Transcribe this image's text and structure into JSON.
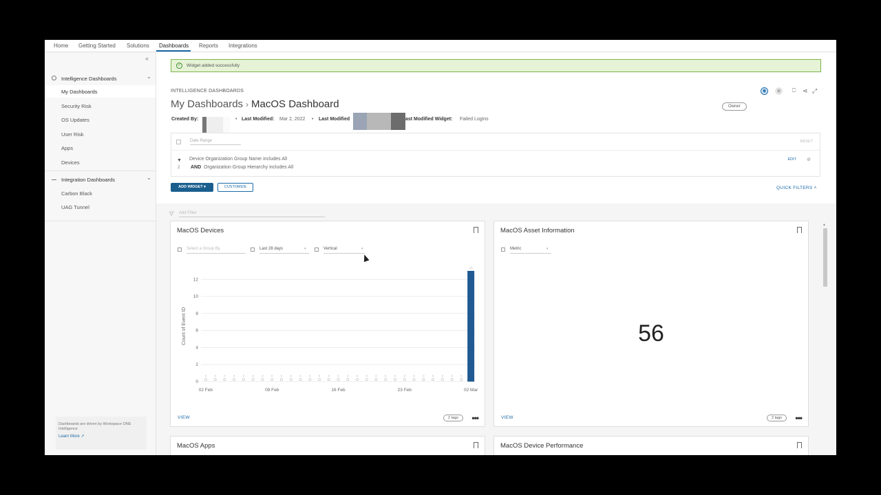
{
  "nav": {
    "items": [
      "Home",
      "Getting Started",
      "Solutions",
      "Dashboards",
      "Reports",
      "Integrations"
    ]
  },
  "sidebar": {
    "groups": [
      {
        "label": "Intelligence Dashboards",
        "items": [
          "My Dashboards",
          "Security Risk",
          "OS Updates",
          "User Risk",
          "Apps",
          "Devices"
        ]
      },
      {
        "label": "Integration Dashboards",
        "items": [
          "Carbon Black",
          "UAG Tunnel"
        ]
      }
    ],
    "footer_text": "Dashboards are driven by Workspace ONE Intelligence",
    "learn_more": "Learn More ↗"
  },
  "alert": "Widget added successfully",
  "page": {
    "eyebrow": "INTELLIGENCE DASHBOARDS",
    "crumb_parent": "My Dashboards",
    "crumb_sep": "›",
    "title": "MacOS Dashboard",
    "owner": "Owner",
    "meta": {
      "created_by_label": "Created By:",
      "last_modified_label": "Last Modified:",
      "last_modified_value": "Mar 2, 2022",
      "last_modified_by_label": "Last Modified",
      "last_widget_label": "ast Modified Widget:",
      "last_widget_value": "Failed Logins"
    }
  },
  "filters": {
    "date_placeholder": "Date Range",
    "reset": "RESET",
    "line1": "Device Organization Group Name includes All",
    "num": "2",
    "and_label": "AND",
    "line2": "Organization Group Hierarchy includes All",
    "edit": "EDIT"
  },
  "actions": {
    "add_widget": "ADD WIDGET ▾",
    "customize": "CUSTOMIZE",
    "quick_filters": "QUICK FILTERS ˄",
    "add_filter_placeholder": "Add Filter"
  },
  "widgets": {
    "devices": {
      "title": "MacOS Devices",
      "group_by_placeholder": "Select a Group By",
      "period": "Last 28 days",
      "orientation": "Vertical",
      "view": "VIEW",
      "tags": "2 tags",
      "more": "•••"
    },
    "asset": {
      "title": "MacOS Asset Information",
      "metric_label": "Metric",
      "value": "56",
      "view": "VIEW",
      "tags": "2 tags",
      "more": "•••"
    },
    "apps": {
      "title": "MacOS Apps"
    },
    "performance": {
      "title": "MacOS Device Performance"
    }
  },
  "chart_data": {
    "type": "bar",
    "ylabel": "Count of Event ID",
    "ylim": [
      0,
      13
    ],
    "yticks": [
      0,
      2,
      4,
      6,
      8,
      10,
      12
    ],
    "xtick_labels": [
      "02 Feb",
      "09 Feb",
      "16 Feb",
      "23 Feb",
      "02 Mar"
    ],
    "series": [
      {
        "values": [
          0,
          0,
          0,
          0,
          0,
          0,
          0,
          0,
          0,
          0,
          0,
          0,
          0,
          0,
          0,
          0,
          0,
          0,
          0,
          0,
          0,
          0,
          0,
          0,
          0,
          0,
          0,
          0,
          13
        ]
      }
    ],
    "colors": {
      "bar": "#1f5a92",
      "zero_marker": "#cccccc"
    },
    "data_labels": [
      "0",
      "0",
      "0",
      "0",
      "0",
      "0",
      "0",
      "0",
      "0",
      "0",
      "0",
      "0",
      "0",
      "0",
      "0",
      "0",
      "0",
      "0",
      "0",
      "0",
      "0",
      "0",
      "0",
      "0",
      "0",
      "0",
      "0",
      "0",
      "13"
    ]
  }
}
